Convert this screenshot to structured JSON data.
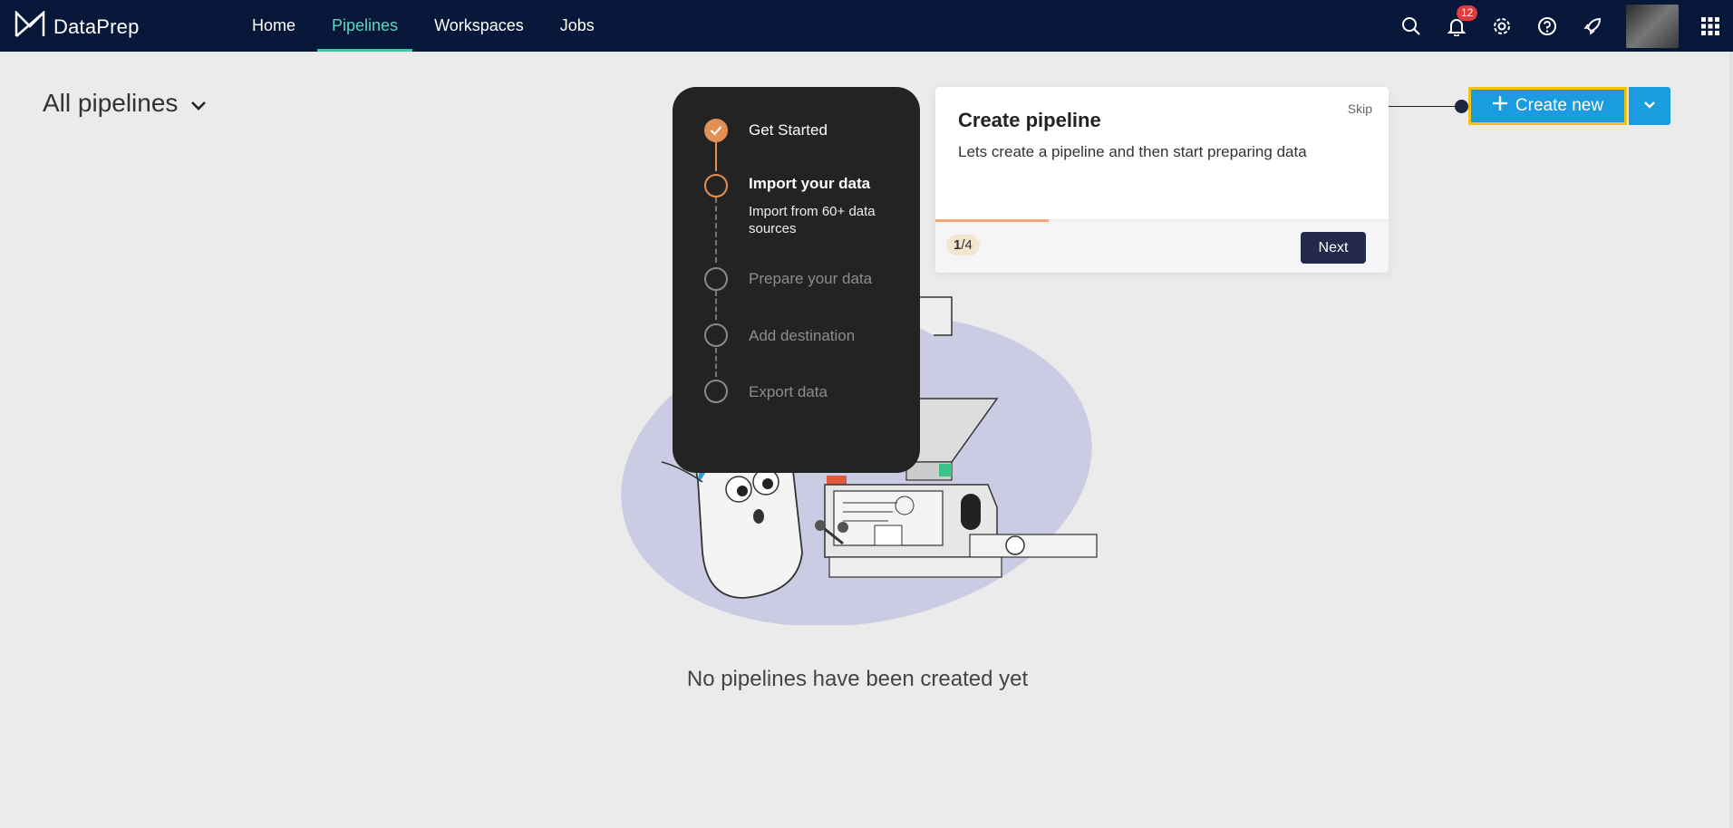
{
  "app": {
    "brand": "DataPrep",
    "nav": [
      {
        "label": "Home",
        "active": false
      },
      {
        "label": "Pipelines",
        "active": true
      },
      {
        "label": "Workspaces",
        "active": false
      },
      {
        "label": "Jobs",
        "active": false
      }
    ],
    "notification_count": "12",
    "icons": [
      "search-icon",
      "bell-icon",
      "gear-icon",
      "help-icon",
      "rocket-icon",
      "avatar",
      "apps-grid-icon"
    ]
  },
  "page": {
    "title": "All pipelines",
    "empty_message": "No pipelines have been created yet"
  },
  "create": {
    "label": "Create new"
  },
  "steps": [
    {
      "title": "Get Started",
      "state": "done"
    },
    {
      "title": "Import your data",
      "state": "current",
      "description": "Import from 60+ data sources"
    },
    {
      "title": "Prepare your data",
      "state": "pending"
    },
    {
      "title": "Add destination",
      "state": "pending"
    },
    {
      "title": "Export data",
      "state": "pending"
    }
  ],
  "tour": {
    "title": "Create pipeline",
    "description": "Lets create a pipeline and then start preparing data",
    "skip": "Skip",
    "counter_current": "1",
    "counter_total": "/4",
    "progress": 0.25,
    "next": "Next"
  },
  "colors": {
    "nav_bg": "#06173a",
    "nav_active": "#39c7a8",
    "primary": "#1b9be0",
    "highlight": "#f2c218",
    "step_accent": "#e39055"
  }
}
